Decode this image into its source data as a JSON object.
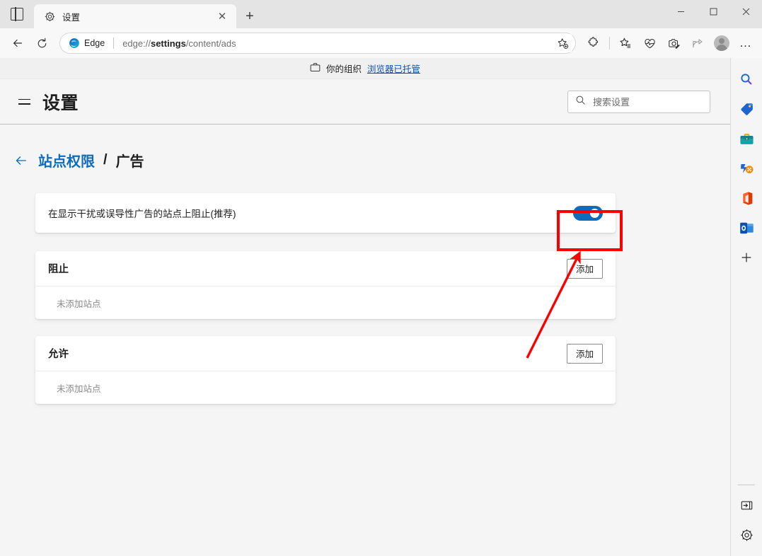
{
  "window": {
    "tab_actions_icon": "vertical-tabs-icon",
    "tab": {
      "favicon": "gear-icon",
      "title": "设置",
      "close_icon": "✕"
    },
    "new_tab_label": "+",
    "controls": {
      "minimize": "—",
      "maximize": "☐",
      "close": "✕"
    }
  },
  "toolbar": {
    "back_icon": "arrow-left-icon",
    "refresh_icon": "refresh-icon",
    "edge_label": "Edge",
    "url_prefix": "edge://",
    "url_bold": "settings",
    "url_suffix": "/content/ads",
    "url_full": "edge://settings/content/ads",
    "add_favorite_icon": "add-favorite-icon",
    "extensions_icon": "puzzle-icon",
    "favorites_icon": "favorites-star-icon",
    "collections_icon": "heart-pulse-icon",
    "screenshot_icon": "camera-capture-icon",
    "share_icon": "share-icon",
    "profile_icon": "avatar-icon",
    "more_icon": "…"
  },
  "org_banner": {
    "icon": "briefcase-icon",
    "text": "你的组织",
    "link": "浏览器已托管"
  },
  "settings": {
    "menu_icon": "hamburger-menu-icon",
    "title": "设置",
    "search": {
      "icon": "search-icon",
      "placeholder": "搜索设置"
    }
  },
  "breadcrumb": {
    "back_icon": "arrow-left-icon",
    "parent": "站点权限",
    "separator": "/",
    "current": "广告"
  },
  "main": {
    "toggle_row": {
      "label": "在显示干扰或误导性广告的站点上阻止(推荐)",
      "state": "on"
    },
    "sections": [
      {
        "title": "阻止",
        "add_label": "添加",
        "empty_text": "未添加站点"
      },
      {
        "title": "允许",
        "add_label": "添加",
        "empty_text": "未添加站点"
      }
    ]
  },
  "rail": {
    "items": [
      {
        "icon": "bing-search-icon",
        "name": "search"
      },
      {
        "icon": "shopping-tag-icon",
        "name": "shopping"
      },
      {
        "icon": "tools-briefcase-icon",
        "name": "tools"
      },
      {
        "icon": "games-icon",
        "name": "games"
      },
      {
        "icon": "office-icon",
        "name": "office"
      },
      {
        "icon": "outlook-icon",
        "name": "outlook"
      },
      {
        "icon": "plus-icon",
        "name": "add"
      }
    ],
    "bottom": [
      {
        "icon": "expand-panel-icon",
        "name": "expand-sidebar"
      },
      {
        "icon": "gear-icon",
        "name": "sidebar-settings"
      }
    ]
  },
  "annotations": {
    "highlight_color": "#fc0000",
    "highlight_target": "toggle-switch",
    "arrow_color": "#fc0000"
  }
}
